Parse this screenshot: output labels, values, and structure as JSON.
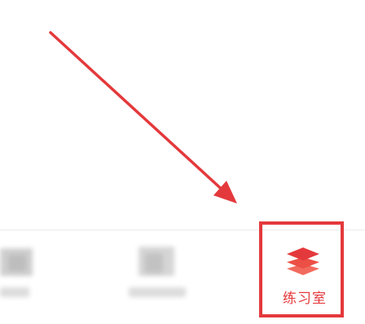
{
  "tabbar": {
    "tabs": [
      {
        "label": "",
        "obscured": true
      },
      {
        "label": "",
        "obscured": true
      },
      {
        "label": "练习室",
        "icon": "stack-layers-icon",
        "highlighted": true
      }
    ]
  },
  "annotation": {
    "arrow_color": "#e4393c",
    "highlight_color": "#e4393c"
  },
  "colors": {
    "accent": "#e4393c"
  }
}
